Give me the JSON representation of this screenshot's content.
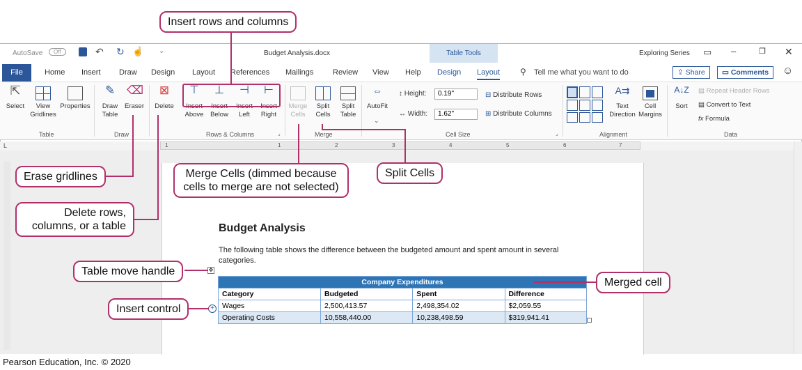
{
  "app": {
    "autosave": "AutoSave",
    "autosave_state": "Off",
    "doc_title": "Budget Analysis.docx",
    "contextual": "Table Tools",
    "series": "Exploring Series"
  },
  "tabs": [
    "File",
    "Home",
    "Insert",
    "Draw",
    "Design",
    "Layout",
    "References",
    "Mailings",
    "Review",
    "View",
    "Help",
    "Design",
    "Layout"
  ],
  "tell_me": "Tell me what you want to do",
  "share": "Share",
  "comments": "Comments",
  "ribbon": {
    "table": {
      "select": "Select",
      "view_gridlines": "View Gridlines",
      "properties": "Properties",
      "label": "Table"
    },
    "draw": {
      "draw_table": "Draw Table",
      "eraser": "Eraser",
      "label": "Draw"
    },
    "delete": "Delete",
    "rows_cols": {
      "insert_above": "Insert Above",
      "insert_below": "Insert Below",
      "insert_left": "Insert Left",
      "insert_right": "Insert Right",
      "label": "Rows & Columns"
    },
    "merge": {
      "merge_cells": "Merge Cells",
      "split_cells": "Split Cells",
      "split_table": "Split Table",
      "label": "Merge"
    },
    "autofit": "AutoFit",
    "cell_size": {
      "height_label": "Height:",
      "height_value": "0.19\"",
      "width_label": "Width:",
      "width_value": "1.62\"",
      "distribute_rows": "Distribute Rows",
      "distribute_columns": "Distribute Columns",
      "label": "Cell Size"
    },
    "alignment": {
      "text_direction": "Text Direction",
      "cell_margins": "Cell Margins",
      "label": "Alignment"
    },
    "data": {
      "sort": "Sort",
      "repeat_header": "Repeat Header Rows",
      "convert": "Convert to Text",
      "formula": "Formula",
      "label": "Data"
    }
  },
  "ruler_numbers": [
    "1",
    "1",
    "2",
    "3",
    "4",
    "5",
    "6",
    "7"
  ],
  "document": {
    "heading": "Budget Analysis",
    "body": "The following table shows the difference between the budgeted amount and spent amount in several categories.",
    "table_title": "Company Expenditures",
    "columns": [
      "Category",
      "Budgeted",
      "Spent",
      "Difference"
    ],
    "rows": [
      [
        "Wages",
        "2,500,413.57",
        "2,498,354.02",
        "$2,059.55"
      ],
      [
        "Operating Costs",
        "10,558,440.00",
        "10,238,498.59",
        "$319,941.41"
      ]
    ]
  },
  "callouts": {
    "insert_rows_cols": "Insert rows and columns",
    "erase": "Erase gridlines",
    "delete": "Delete rows, columns, or a table",
    "merge": "Merge Cells (dimmed because cells to merge are not selected)",
    "split": "Split Cells",
    "move_handle": "Table move handle",
    "insert_control": "Insert control",
    "merged": "Merged cell"
  },
  "copyright": "Pearson Education, Inc. © 2020",
  "colors": {
    "accent": "#2b579a",
    "callout": "#b0306a",
    "table_header": "#2e75b6"
  }
}
